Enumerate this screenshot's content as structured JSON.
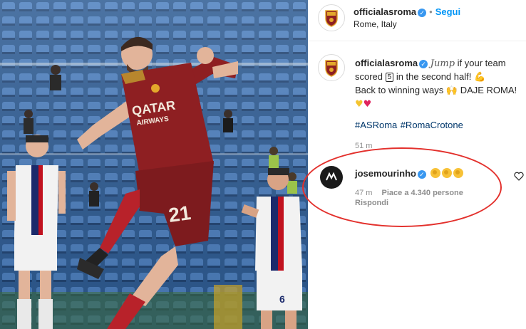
{
  "post": {
    "author": "officialasroma",
    "follow_label": "Segui",
    "location": "Rome, Italy"
  },
  "caption": {
    "author": "officialasroma",
    "styled_word": "Jump",
    "part1": " if your team scored ",
    "boxed_number": "5",
    "part2": " in the second half! ",
    "line2": "Back to winning ways ",
    "line2b": " DAJE ROMA!",
    "hashtags": [
      "#ASRoma",
      "#RomaCrotone"
    ],
    "time": "51 m"
  },
  "comment": {
    "author": "josemourinho",
    "time": "47 m",
    "likes": "Piace a 4.340 persone",
    "reply_label": "Rispondi"
  },
  "photo": {
    "shirt_sponsor_1": "QATAR",
    "shirt_sponsor_2": "AIRWAYS",
    "shirt_number": "21",
    "opponent_number": "6"
  },
  "colors": {
    "roma_red": "#8e1f22",
    "verified_blue": "#3897f0",
    "follow_blue": "#0095f6",
    "highlight_ring": "#e3302c"
  },
  "icons": [
    "roma-crest-icon",
    "verified-badge-icon",
    "heart-icon",
    "muscle-emoji",
    "raising-hands-emoji",
    "yellow-heart-emoji",
    "red-heart-emoji",
    "clapping-hands-emoji"
  ]
}
